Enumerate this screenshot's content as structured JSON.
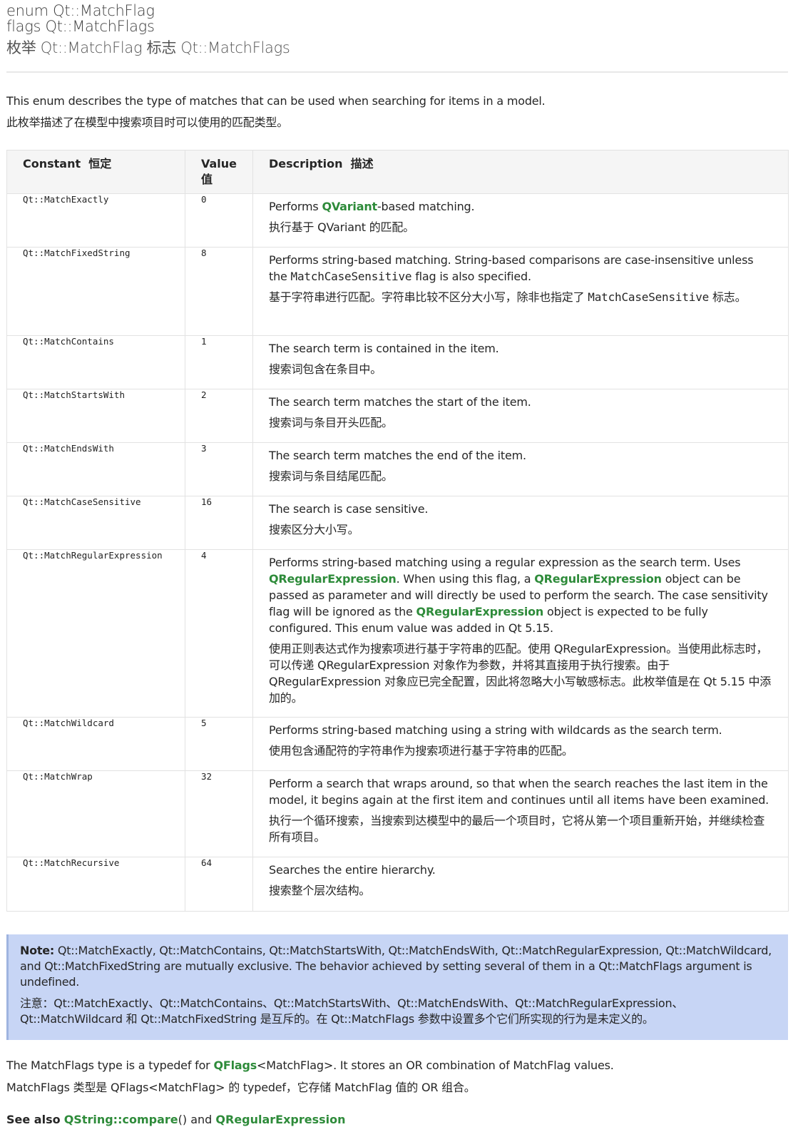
{
  "header": {
    "line1": "enum Qt::MatchFlag",
    "line2": "flags Qt::MatchFlags",
    "line3": "枚举 Qt::MatchFlag 标志 Qt::MatchFlags"
  },
  "intro": {
    "en": "This enum describes the type of matches that can be used when searching for items in a model.",
    "zh": "此枚举描述了在模型中搜索项目时可以使用的匹配类型。"
  },
  "table": {
    "headers": {
      "constant_en": "Constant",
      "constant_zh": "恒定",
      "value_en": "Value",
      "value_zh": "值",
      "description_en": "Description",
      "description_zh": "描述"
    },
    "rows": [
      {
        "constant": "Qt::MatchExactly",
        "value": "0",
        "en_pre": "Performs ",
        "en_link": "QVariant",
        "en_post": "-based matching.",
        "zh": "执行基于 QVariant 的匹配。"
      },
      {
        "constant": "Qt::MatchFixedString",
        "value": "8",
        "en_pre": "Performs string-based matching. String-based comparisons are case-insensitive unless the ",
        "en_code": "MatchCaseSensitive",
        "en_post": " flag is also specified.",
        "zh_pre": "基于字符串进行匹配。字符串比较不区分大小写，除非也指定了 ",
        "zh_code": "MatchCaseSensitive",
        "zh_post": " 标志。"
      },
      {
        "constant": "Qt::MatchContains",
        "value": "1",
        "en": "The search term is contained in the item.",
        "zh": "搜索词包含在条目中。"
      },
      {
        "constant": "Qt::MatchStartsWith",
        "value": "2",
        "en": "The search term matches the start of the item.",
        "zh": "搜索词与条目开头匹配。"
      },
      {
        "constant": "Qt::MatchEndsWith",
        "value": "3",
        "en": "The search term matches the end of the item.",
        "zh": "搜索词与条目结尾匹配。"
      },
      {
        "constant": "Qt::MatchCaseSensitive",
        "value": "16",
        "en": "The search is case sensitive.",
        "zh": "搜索区分大小写。"
      },
      {
        "constant": "Qt::MatchRegularExpression",
        "value": "4",
        "en_a": "Performs string-based matching using a regular expression as the search term. Uses ",
        "en_link1": "QRegularExpression",
        "en_b": ". When using this flag, a ",
        "en_link2": "QRegularExpression",
        "en_c": " object can be passed as parameter and will directly be used to perform the search. The case sensitivity flag will be ignored as the ",
        "en_link3": "QRegularExpression",
        "en_d": " object is expected to be fully configured. This enum value was added in Qt 5.15.",
        "zh": "使用正则表达式作为搜索项进行基于字符串的匹配。使用 QRegularExpression。当使用此标志时，可以传递 QRegularExpression 对象作为参数，并将其直接用于执行搜索。由于 QRegularExpression 对象应已完全配置，因此将忽略大小写敏感标志。此枚举值是在 Qt 5.15 中添加的。"
      },
      {
        "constant": "Qt::MatchWildcard",
        "value": "5",
        "en": "Performs string-based matching using a string with wildcards as the search term.",
        "zh": "使用包含通配符的字符串作为搜索项进行基于字符串的匹配。"
      },
      {
        "constant": "Qt::MatchWrap",
        "value": "32",
        "en": "Perform a search that wraps around, so that when the search reaches the last item in the model, it begins again at the first item and continues until all items have been examined.",
        "zh": "执行一个循环搜索，当搜索到达模型中的最后一个项目时，它将从第一个项目重新开始，并继续检查所有项目。"
      },
      {
        "constant": "Qt::MatchRecursive",
        "value": "64",
        "en": "Searches the entire hierarchy.",
        "zh": "搜索整个层次结构。"
      }
    ]
  },
  "note": {
    "label": "Note:",
    "en": " Qt::MatchExactly, Qt::MatchContains, Qt::MatchStartsWith, Qt::MatchEndsWith, Qt::MatchRegularExpression, Qt::MatchWildcard, and Qt::MatchFixedString are mutually exclusive. The behavior achieved by setting several of them in a Qt::MatchFlags argument is undefined.",
    "zh": "注意：Qt::MatchExactly、Qt::MatchContains、Qt::MatchStartsWith、Qt::MatchEndsWith、Qt::MatchRegularExpression、Qt::MatchWildcard 和 Qt::MatchFixedString 是互斥的。在 Qt::MatchFlags 参数中设置多个它们所实现的行为是未定义的。"
  },
  "outro": {
    "en_pre": "The MatchFlags type is a typedef for ",
    "en_link": "QFlags",
    "en_post": "<MatchFlag>. It stores an OR combination of MatchFlag values.",
    "zh": "MatchFlags 类型是 QFlags<MatchFlag> 的 typedef，它存储 MatchFlag 值的 OR 组合。"
  },
  "seealso": {
    "label": "See also",
    "link1": "QString::compare",
    "sep": "() and ",
    "link2": "QRegularExpression"
  },
  "colors": {
    "link": "#2e8b3a",
    "note_bg": "#c7d5f5",
    "header_bg": "#f5f5f5"
  }
}
